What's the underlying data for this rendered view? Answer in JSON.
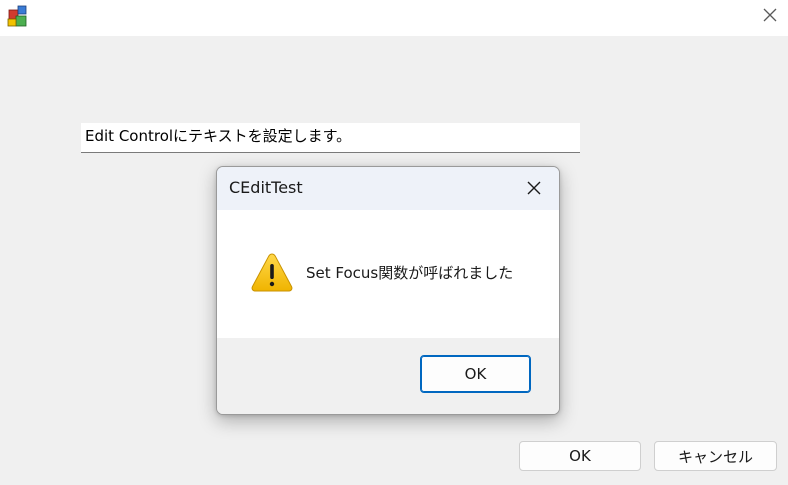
{
  "window": {
    "app_icon": "mfc-app-icon",
    "close_icon": "close-icon"
  },
  "edit_control": {
    "text": "Edit Controlにテキストを設定します。"
  },
  "main_buttons": {
    "ok_label": "OK",
    "cancel_label": "キャンセル"
  },
  "message_box": {
    "title": "CEditTest",
    "message": "Set Focus関数が呼ばれました",
    "icon": "warning-icon",
    "ok_label": "OK",
    "accent_color": "#0067c0",
    "warning_color": "#f5c200"
  }
}
